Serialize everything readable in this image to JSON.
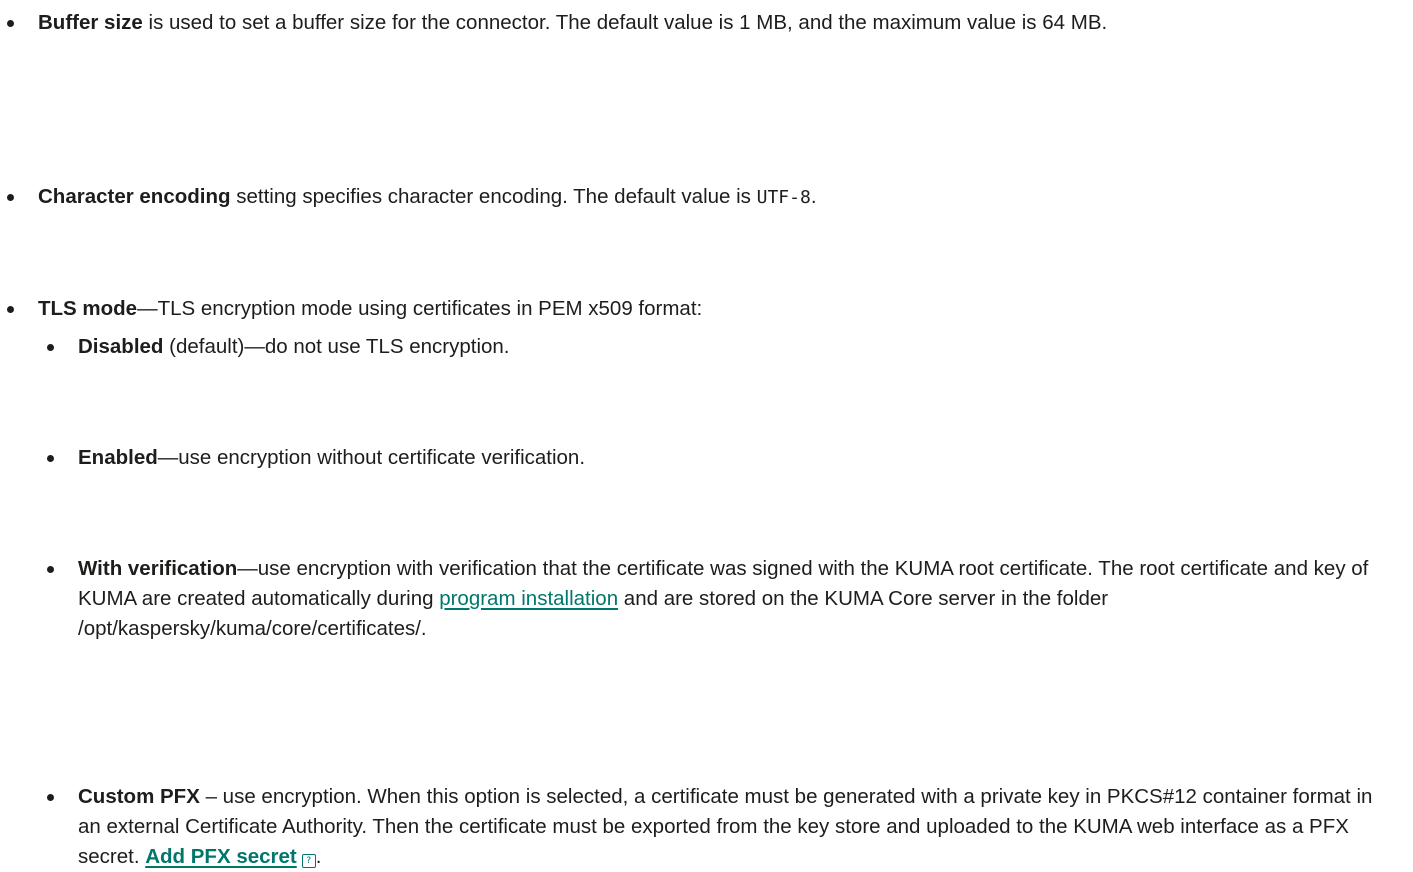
{
  "items": {
    "buffer": {
      "term": "Buffer size",
      "text": " is used to set a buffer size for the connector. The default value is 1 MB, and the maximum value is 64 MB."
    },
    "encoding": {
      "term": "Character encoding",
      "text_before": " setting specifies character encoding. The default value is ",
      "code": "UTF-8",
      "text_after": "."
    },
    "tls": {
      "term": "TLS mode",
      "text": "—TLS encryption mode using certificates in PEM x509 format:"
    }
  },
  "tls_options": {
    "disabled": {
      "term": "Disabled",
      "text": " (default)—do not use TLS encryption."
    },
    "enabled": {
      "term": "Enabled",
      "text": "—use encryption without certificate verification."
    },
    "verification": {
      "term": "With verification",
      "text_before": "—use encryption with verification that the certificate was signed with the KUMA root certificate. The root certificate and key of KUMA are created automatically during ",
      "link": "program installation",
      "text_after": " and are stored on the KUMA Core server in the folder /opt/kaspersky/kuma/core/certificates/."
    },
    "custom_pfx": {
      "term": "Custom PFX",
      "text": " – use encryption. When this option is selected, a certificate must be generated with a private key in PKCS#12 container format in an external Certificate Authority. Then the certificate must be exported from the key store and uploaded to the KUMA web interface as a PFX secret. ",
      "link": "Add PFX secret",
      "link_icon": "external-help-icon",
      "text_after": "."
    }
  },
  "colors": {
    "text": "#1d1d1b",
    "link": "#00776b"
  }
}
